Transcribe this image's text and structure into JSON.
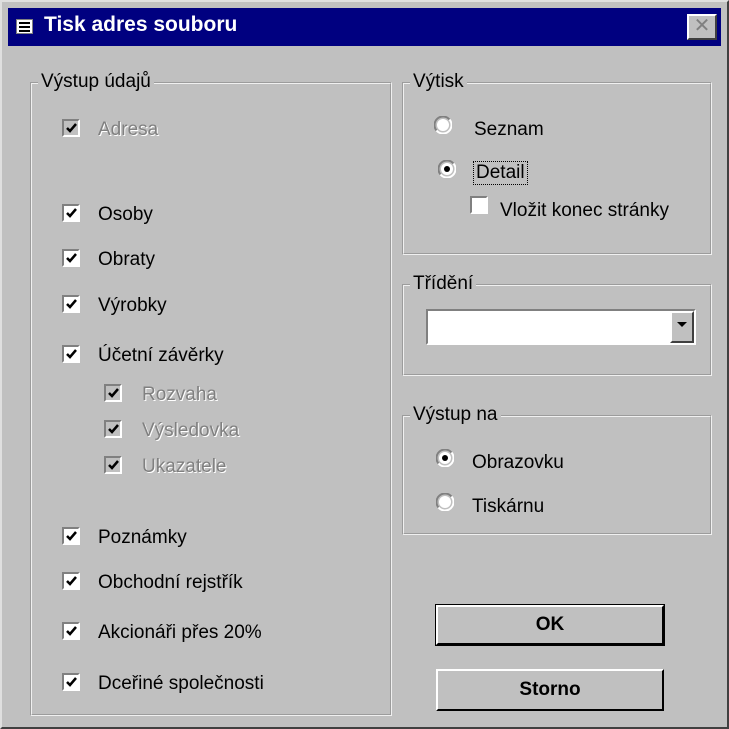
{
  "window": {
    "title": "Tisk adres souboru",
    "close_symbol": "✕"
  },
  "output_data": {
    "legend": "Výstup údajů",
    "items": [
      {
        "label": "Adresa",
        "checked": true,
        "enabled": false
      },
      {
        "label": "Osoby",
        "checked": true,
        "enabled": true
      },
      {
        "label": "Obraty",
        "checked": true,
        "enabled": true
      },
      {
        "label": "Výrobky",
        "checked": true,
        "enabled": true
      },
      {
        "label": "Účetní závěrky",
        "checked": true,
        "enabled": true
      },
      {
        "label": "Rozvaha",
        "checked": true,
        "enabled": false
      },
      {
        "label": "Výsledovka",
        "checked": true,
        "enabled": false
      },
      {
        "label": "Ukazatele",
        "checked": true,
        "enabled": false
      },
      {
        "label": "Poznámky",
        "checked": true,
        "enabled": true
      },
      {
        "label": "Obchodní rejstřík",
        "checked": true,
        "enabled": true
      },
      {
        "label": "Akcionáři přes 20%",
        "checked": true,
        "enabled": true
      },
      {
        "label": "Dceřiné společnosti",
        "checked": true,
        "enabled": true
      }
    ]
  },
  "print_type": {
    "legend": "Výtisk",
    "options": [
      {
        "label": "Seznam",
        "selected": false
      },
      {
        "label": "Detail",
        "selected": true
      }
    ],
    "page_break_label": "Vložit konec stránky",
    "page_break_checked": false
  },
  "sorting": {
    "legend": "Třídění",
    "value": ""
  },
  "output_to": {
    "legend": "Výstup na",
    "options": [
      {
        "label": "Obrazovku",
        "selected": true
      },
      {
        "label": "Tiskárnu",
        "selected": false
      }
    ]
  },
  "buttons": {
    "ok": "OK",
    "cancel": "Storno"
  },
  "colors": {
    "title_bar": "#000080",
    "face": "#c0c0c0",
    "disabled_text": "#808080"
  }
}
